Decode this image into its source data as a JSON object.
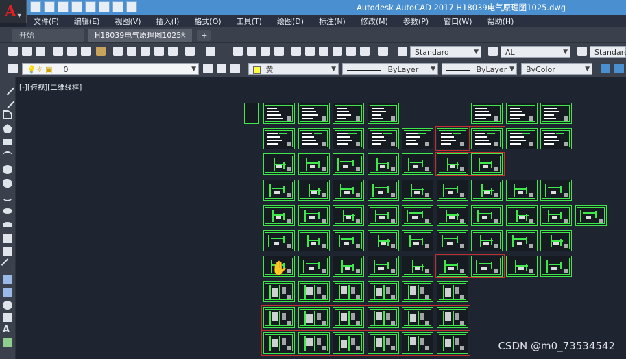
{
  "app": {
    "title": "Autodesk AutoCAD 2017     H18039电气原理图1025.dwg",
    "logo_letter": "A"
  },
  "menu": [
    "文件(F)",
    "编辑(E)",
    "视图(V)",
    "插入(I)",
    "格式(O)",
    "工具(T)",
    "绘图(D)",
    "标注(N)",
    "修改(M)",
    "参数(P)",
    "窗口(W)",
    "帮助(H)"
  ],
  "tabs": {
    "start": "开始",
    "drawing": "H18039电气原理图1025*",
    "close": "×",
    "add": "+"
  },
  "toolbar1": {
    "text_style": "Standard",
    "dim_style": "AL",
    "table_style": "Standard"
  },
  "toolbar2": {
    "layer": "0",
    "color": "黄",
    "linetype": "ByLayer",
    "lineweight": "ByLayer",
    "plotstyle": "ByColor"
  },
  "canvas": {
    "view_label": "[-][俯视][二维线框]"
  },
  "watermark": "CSDN @m0_73534542",
  "colors": {
    "titlebar": "#4a90d0",
    "sheet_border": "#3ee84a",
    "selection": "#c0302c",
    "canvas_bg": "#1e2430"
  }
}
